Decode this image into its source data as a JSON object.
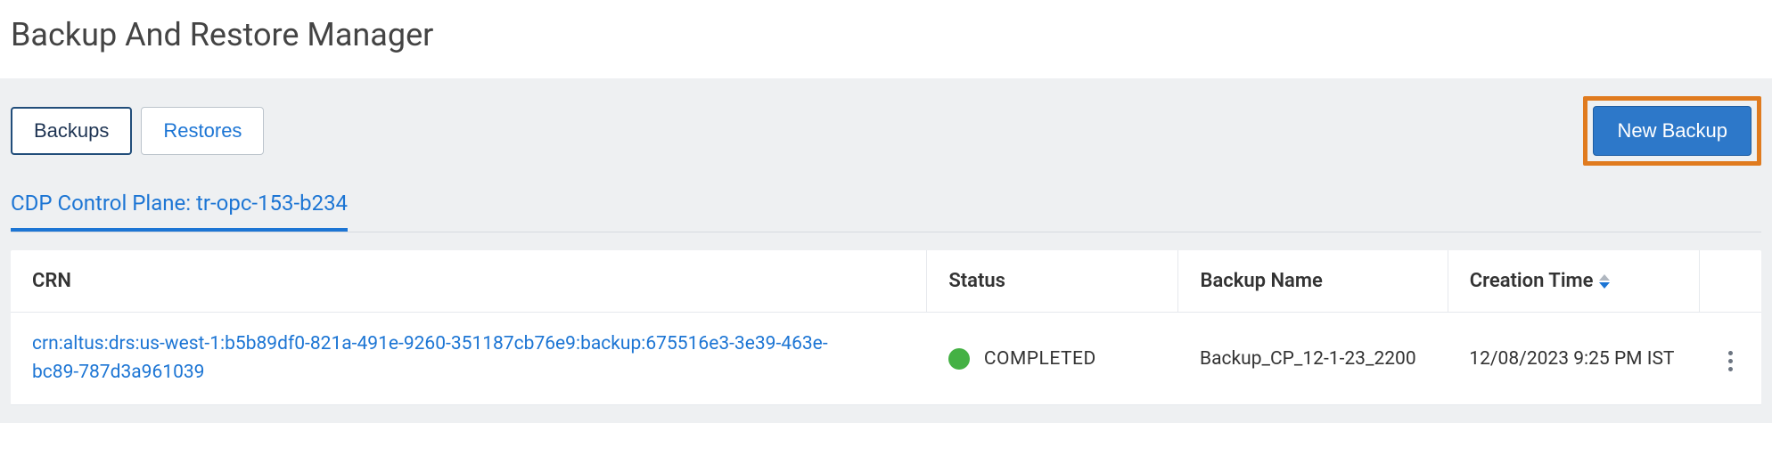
{
  "header": {
    "title": "Backup And Restore Manager"
  },
  "tabs": {
    "backups": "Backups",
    "restores": "Restores"
  },
  "actions": {
    "new_backup": "New Backup"
  },
  "subtab": {
    "label": "CDP Control Plane: tr-opc-153-b234"
  },
  "table": {
    "headers": {
      "crn": "CRN",
      "status": "Status",
      "name": "Backup Name",
      "time": "Creation Time"
    },
    "rows": [
      {
        "crn": "crn:altus:drs:us-west-1:b5b89df0-821a-491e-9260-351187cb76e9:backup:675516e3-3e39-463e-bc89-787d3a961039",
        "status": "COMPLETED",
        "status_color": "#44b144",
        "name": "Backup_CP_12-1-23_2200",
        "time": "12/08/2023 9:25 PM IST"
      }
    ]
  }
}
